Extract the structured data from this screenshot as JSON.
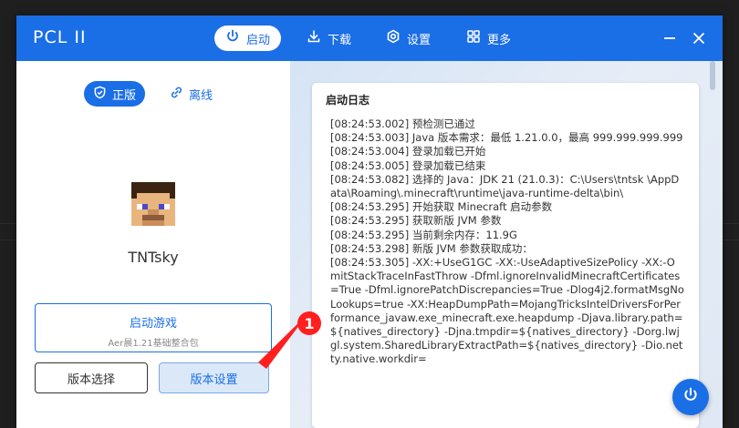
{
  "app": {
    "title": "PCL II"
  },
  "nav": [
    {
      "label": "启动",
      "icon": "power-icon",
      "active": true
    },
    {
      "label": "下载",
      "icon": "download-icon",
      "active": false
    },
    {
      "label": "设置",
      "icon": "gear-icon",
      "active": false
    },
    {
      "label": "更多",
      "icon": "grid-icon",
      "active": false
    }
  ],
  "mode": {
    "online": "正版",
    "offline": "离线"
  },
  "player": {
    "name": "TNTsky"
  },
  "launch": {
    "title": "启动游戏",
    "subtitle": "Aer晨1.21基础整合包"
  },
  "version": {
    "select": "版本选择",
    "settings": "版本设置"
  },
  "annotation": {
    "marker": "1"
  },
  "log": {
    "title": "启动日志",
    "lines": [
      "[08:24:53.002] 预检测已通过",
      "[08:24:53.003] Java 版本需求：最低 1.21.0.0，最高 999.999.999.999",
      "[08:24:53.004] 登录加载已开始",
      "[08:24:53.005] 登录加载已结束",
      "[08:24:53.082] 选择的 Java：JDK 21 (21.0.3)：C:\\Users\\tntsk \\AppData\\Roaming\\.minecraft\\runtime\\java-runtime-delta\\bin\\",
      "[08:24:53.295] 开始获取 Minecraft 启动参数",
      "[08:24:53.295] 获取新版 JVM 参数",
      "[08:24:53.295] 当前剩余内存：11.9G",
      "[08:24:53.298] 新版 JVM 参数获取成功：",
      "[08:24:53.305] -XX:+UseG1GC -XX:-UseAdaptiveSizePolicy -XX:-OmitStackTraceInFastThrow -Dfml.ignoreInvalidMinecraftCertificates=True -Dfml.ignorePatchDiscrepancies=True -Dlog4j2.formatMsgNoLookups=true -XX:HeapDumpPath=MojangTricksIntelDriversForPerformance_javaw.exe_minecraft.exe.heapdump -Djava.library.path=${natives_directory} -Djna.tmpdir=${natives_directory} -Dorg.lwjgl.system.SharedLibraryExtractPath=${natives_directory} -Dio.netty.native.workdir="
    ]
  },
  "colors": {
    "accent": "#1a6ee6",
    "marker": "#ff1f1f"
  }
}
